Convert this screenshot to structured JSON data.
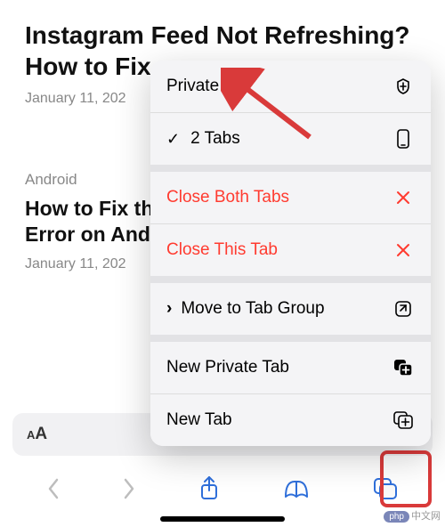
{
  "articles": [
    {
      "title": "Instagram Feed Not Refreshing? How to Fix",
      "date": "January 11, 202"
    },
    {
      "category": "Android",
      "title": "How to Fix the 'Couldn't Read NFC Card' Error on Android",
      "date": "January 11, 202"
    }
  ],
  "aa_label": "AA",
  "menu": {
    "private": "Private",
    "tabs": "2 Tabs",
    "closeBoth": "Close Both Tabs",
    "closeThis": "Close This Tab",
    "moveGroup": "Move to Tab Group",
    "newPrivate": "New Private Tab",
    "newTab": "New Tab"
  },
  "colors": {
    "destructive": "#ff3b30",
    "toolbar_blue": "#2f6fda",
    "highlight": "#d93a3a"
  },
  "watermark": {
    "badge": "php",
    "text": "中文网"
  }
}
